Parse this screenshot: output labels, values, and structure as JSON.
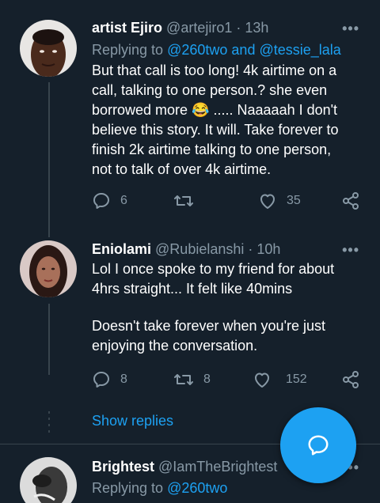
{
  "tweets": [
    {
      "name": "artist Ejiro",
      "handle": "@artejiro1",
      "time": "· 13h",
      "replying_prefix": "Replying to",
      "replying_mention_1": "@260two",
      "replying_and": "and",
      "replying_mention_2": "@tessie_lala",
      "text_line_1": "But that call is too long! 4k airtime on a",
      "text_line_2": "call, talking to one person.? she even",
      "text_line_3a": "borrowed more",
      "emoji": "😂",
      "text_line_3b": "..... Naaaaah I don't",
      "text_line_4": "believe this story. It will. Take forever to",
      "text_line_5": "finish 2k airtime talking to one person,",
      "text_line_6": "not to talk of over 4k airtime.",
      "reply_count": "6",
      "retweet_count": "",
      "like_count": "35"
    },
    {
      "name": "Eniolami",
      "handle": "@Rubielanshi",
      "time": "· 10h",
      "text_line_1": "Lol I once spoke to my friend for about",
      "text_line_2": "4hrs straight... It felt like 40mins",
      "text_line_3": "Doesn't take forever when you're just",
      "text_line_4": "enjoying the conversation.",
      "reply_count": "8",
      "retweet_count": "8",
      "like_count": "152"
    },
    {
      "name": "Brightest",
      "handle": "@IamTheBrightest",
      "replying_prefix": "Replying to",
      "replying_mention_1": "@260two"
    }
  ],
  "show_replies": "Show replies",
  "more_glyph": "•••",
  "colors": {
    "background": "#15202b",
    "accent": "#1da1f2",
    "muted": "#8899a6",
    "border": "#38444d"
  },
  "icons": [
    "reply-icon",
    "retweet-icon",
    "like-icon",
    "share-icon",
    "more-icon",
    "compose-reply-icon"
  ]
}
